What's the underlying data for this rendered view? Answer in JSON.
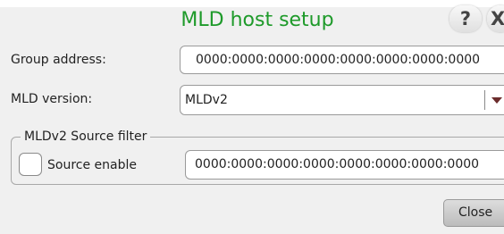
{
  "dialog": {
    "title": "MLD host setup",
    "help_button_label": "?",
    "close_x_label": "X"
  },
  "group_address": {
    "label": "Group address:",
    "value": "0000:0000:0000:0000:0000:0000:0000:0000"
  },
  "mld_version": {
    "label": "MLD version:",
    "selected": "MLDv2",
    "arrow_icon": "triangle-down-icon"
  },
  "source_filter": {
    "legend": "MLDv2 Source filter",
    "checkbox_label": "Source enable",
    "checked": false,
    "address_value": "0000:0000:0000:0000:0000:0000:0000:0000"
  },
  "footer": {
    "close_label": "Close"
  },
  "colors": {
    "title": "#1e9a2a",
    "dialog_background": "#f0f0f0",
    "field_background": "#ffffff",
    "dropdown_arrow": "#6b2c2c"
  }
}
